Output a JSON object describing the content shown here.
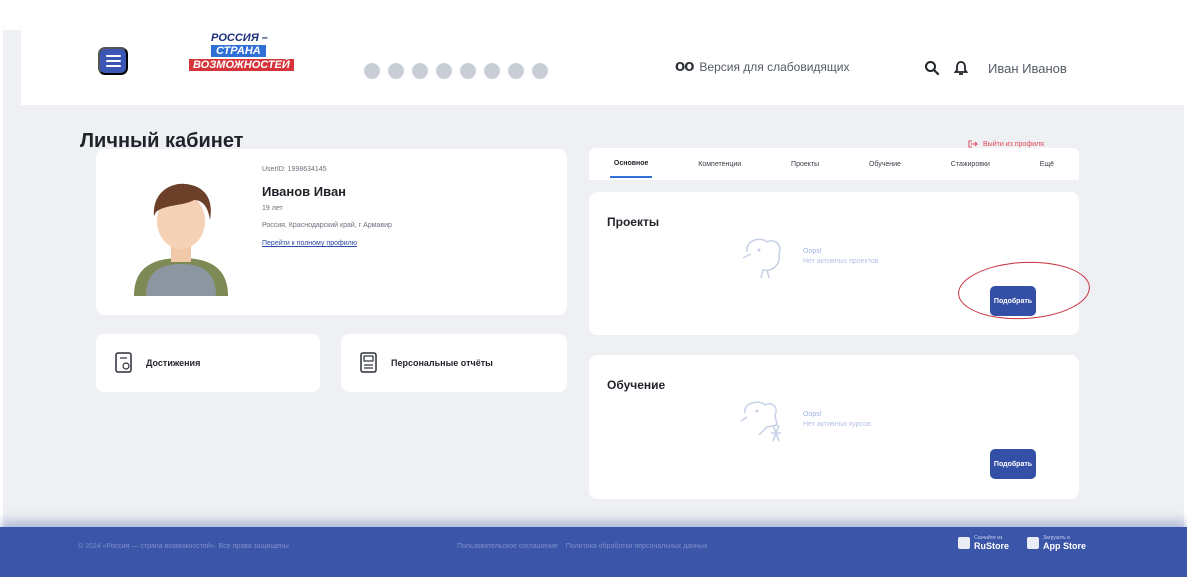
{
  "header": {
    "logo": {
      "line1": "РОССИЯ –",
      "line2": "СТРАНА",
      "line3": "ВОЗМОЖНОСТЕЙ"
    },
    "social_icons": [
      "vk-icon",
      "ok-icon",
      "youtube-icon",
      "rutube-icon",
      "telegram-icon",
      "dzen-icon",
      "yappy-icon",
      "tenchat-icon"
    ],
    "vision_label": "Версия для слабовидящих",
    "user_name": "Иван Иванов"
  },
  "page": {
    "title": "Личный кабинет",
    "logout_label": "Выйти из профиля"
  },
  "profile": {
    "user_id": "UserID: 1998634145",
    "name": "Иванов Иван",
    "age": "19 лет",
    "location": "Россия, Краснодарский край, г Армавир",
    "full_profile_link": "Перейти к полному профилю"
  },
  "quick_cards": {
    "achievements": "Достижения",
    "reports": "Персональные отчёты"
  },
  "tabs": [
    {
      "label": "Основное",
      "active": true
    },
    {
      "label": "Компетенции",
      "active": false
    },
    {
      "label": "Проекты",
      "active": false
    },
    {
      "label": "Обучение",
      "active": false
    },
    {
      "label": "Стажировки",
      "active": false
    },
    {
      "label": "Ещё",
      "active": false
    }
  ],
  "sections": {
    "projects": {
      "title": "Проекты",
      "oops": "Oops!",
      "empty": "Нет активных проектов",
      "button": "Подобрать"
    },
    "learning": {
      "title": "Обучение",
      "oops": "Oops!",
      "empty": "Нет активных курсов",
      "button": "Подобрать"
    }
  },
  "footer": {
    "copyright": "© 2024 «Россия — страна возможностей». Все права защищены",
    "links": [
      "Пользовательское соглашение",
      "Политика обработки персональных данных"
    ],
    "stores": [
      {
        "line1": "Скачайте из",
        "line2": "RuStore"
      },
      {
        "line1": "Загрузить в",
        "line2": "App Store"
      }
    ]
  },
  "colors": {
    "accent": "#3b56b5",
    "button": "#3450a6",
    "logout": "#e24a59",
    "annotation_circle": "#c8323e",
    "footer": "#3b55a8"
  }
}
